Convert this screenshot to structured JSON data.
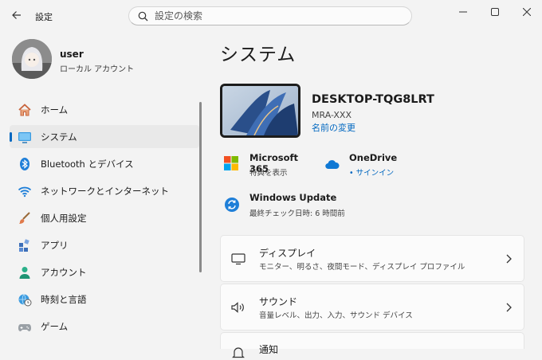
{
  "window": {
    "title": "設定"
  },
  "search": {
    "placeholder": "設定の検索"
  },
  "user": {
    "name": "user",
    "account_type": "ローカル アカウント"
  },
  "sidebar": {
    "items": [
      {
        "label": "ホーム",
        "icon": "home-icon"
      },
      {
        "label": "システム",
        "icon": "monitor-icon",
        "active": true
      },
      {
        "label": "Bluetooth とデバイス",
        "icon": "bluetooth-icon"
      },
      {
        "label": "ネットワークとインターネット",
        "icon": "wifi-icon"
      },
      {
        "label": "個人用設定",
        "icon": "brush-icon"
      },
      {
        "label": "アプリ",
        "icon": "apps-icon"
      },
      {
        "label": "アカウント",
        "icon": "person-icon"
      },
      {
        "label": "時刻と言語",
        "icon": "globe-clock-icon"
      },
      {
        "label": "ゲーム",
        "icon": "gamepad-icon"
      }
    ]
  },
  "main": {
    "title": "システム",
    "device": {
      "name": "DESKTOP-TQG8LRT",
      "model": "MRA-XXX",
      "rename": "名前の変更"
    },
    "quick": {
      "m365": {
        "title": "Microsoft 365",
        "subtitle": "特典を表示"
      },
      "onedrive": {
        "title": "OneDrive",
        "subtitle": "• サインイン"
      },
      "update": {
        "title": "Windows Update",
        "subtitle": "最終チェック日時: 6 時間前"
      }
    },
    "cards": [
      {
        "title": "ディスプレイ",
        "subtitle": "モニター、明るさ、夜間モード、ディスプレイ プロファイル",
        "icon": "display-icon"
      },
      {
        "title": "サウンド",
        "subtitle": "音量レベル、出力、入力、サウンド デバイス",
        "icon": "speaker-icon"
      },
      {
        "title": "通知",
        "subtitle": "",
        "icon": "bell-icon"
      }
    ]
  },
  "colors": {
    "accent": "#0067c0",
    "background": "#f3f3f3",
    "card": "#fbfbfb"
  }
}
